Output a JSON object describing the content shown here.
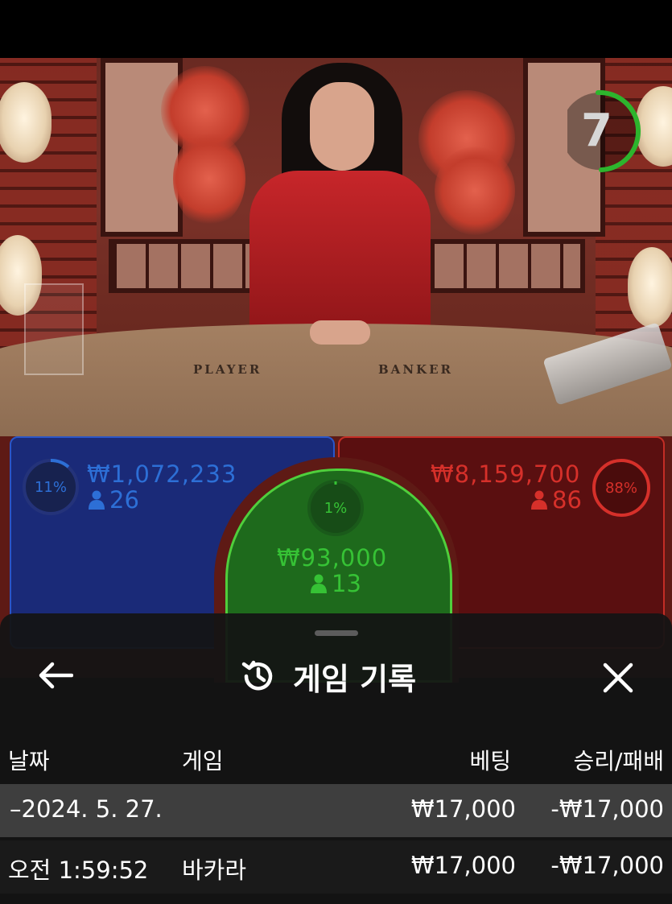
{
  "table": {
    "player_label": "PLAYER",
    "banker_label": "BANKER"
  },
  "timer": {
    "value": "7",
    "color": "#2db52d"
  },
  "bets": {
    "player": {
      "percent": "11%",
      "amount": "₩1,072,233",
      "players": "26",
      "color": "#2d6fd6"
    },
    "tie": {
      "percent": "1%",
      "amount": "₩93,000",
      "players": "13",
      "color": "#36c235"
    },
    "banker": {
      "percent": "88%",
      "amount": "₩8,159,700",
      "players": "86",
      "color": "#d6302a"
    }
  },
  "sheet": {
    "title": "게임 기록",
    "back_icon": "arrow-left-icon",
    "history_icon": "history-icon",
    "close_icon": "close-icon",
    "columns": {
      "date": "날짜",
      "game": "게임",
      "bet": "베팅",
      "result": "승리/패배"
    },
    "rows": [
      {
        "date": "2024. 5. 27.",
        "game": "",
        "bet": "₩17,000",
        "result": "-₩17,000"
      },
      {
        "date": "오전 1:59:52",
        "game": "바카라",
        "bet": "₩17,000",
        "result": "-₩17,000"
      }
    ]
  }
}
